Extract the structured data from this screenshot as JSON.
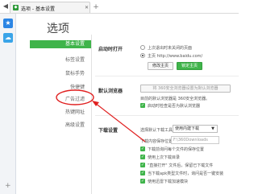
{
  "titlebar": {
    "back_glyph": "◀",
    "tab_title": "选项 - 基本设置",
    "tab_close": "✕",
    "new_tab_glyph": "+"
  },
  "strip": {
    "plus_glyph": "+"
  },
  "page": {
    "title": "选项"
  },
  "sidebar": {
    "items": [
      {
        "label": "基本设置",
        "active": true
      },
      {
        "label": "标签设置",
        "active": false
      },
      {
        "label": "鼠标手势",
        "active": false
      },
      {
        "label": "快捷键",
        "active": false
      },
      {
        "label": "广告过滤",
        "active": false
      },
      {
        "label": "热键网址",
        "active": false
      },
      {
        "label": "高级设置",
        "active": false
      }
    ]
  },
  "startup": {
    "section": "启动时打开",
    "option_last": "上次退出时未关闭的页面",
    "option_home": "主页  http://www.baidu.com/",
    "edit_home": "修改主页",
    "lock_home": "锁定主页"
  },
  "default_browser": {
    "section": "默认浏览器",
    "button": "将 360安全浏览器设置为默认浏览器",
    "status": "目前的默认浏览器是 360安全浏览器。",
    "checkbox": "启动时检查是否为默认浏览器"
  },
  "download": {
    "section": "下载设置",
    "tool_label": "选择默认下载工具：",
    "tool_value": "使用内建下载",
    "dir_label": "下载内容保存位置：",
    "dir_value": "F:\\360Downloads",
    "options": [
      "下载前询问每个文件的保存位置",
      "使用上次下载目录",
      "\"直接打开\" 文件后，保留已下载文件",
      "当下载apk类型文件时，询问是否一键安装",
      "使用迅雷下载加速模块"
    ]
  },
  "colors": {
    "accent_green": "#3fb44a",
    "annotation_red": "#e02020"
  }
}
